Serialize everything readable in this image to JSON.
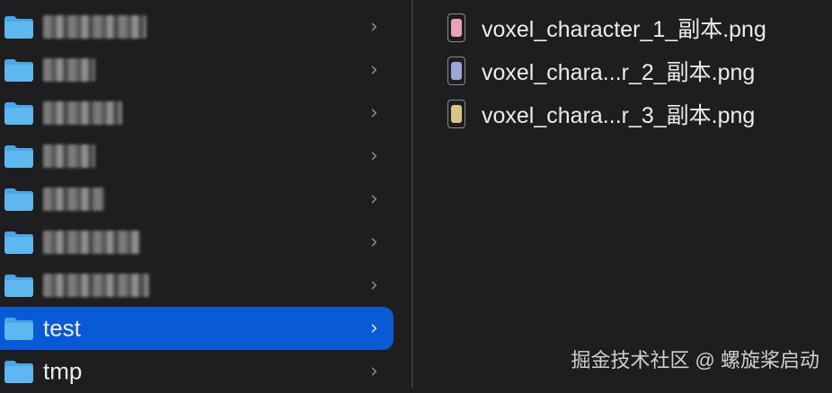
{
  "folders": [
    {
      "name": "ecosystem",
      "obscured": true,
      "selected": false
    },
    {
      "name": "misc",
      "obscured": true,
      "selected": false
    },
    {
      "name": "project",
      "obscured": true,
      "selected": false
    },
    {
      "name": "repo",
      "obscured": true,
      "selected": false
    },
    {
      "name": "data",
      "obscured": true,
      "selected": false
    },
    {
      "name": "design",
      "obscured": true,
      "selected": false
    },
    {
      "name": "software",
      "obscured": true,
      "selected": false
    },
    {
      "name": "test",
      "obscured": false,
      "selected": true
    },
    {
      "name": "tmp",
      "obscured": false,
      "selected": false
    }
  ],
  "chevron": "›",
  "files": [
    {
      "name": "voxel_character_1_副本.png",
      "thumb_color": "#e9a3b6"
    },
    {
      "name": "voxel_chara...r_2_副本.png",
      "thumb_color": "#9aa8d8"
    },
    {
      "name": "voxel_chara...r_3_副本.png",
      "thumb_color": "#d9c48a"
    }
  ],
  "watermark": "掘金技术社区 @ 螺旋桨启动",
  "colors": {
    "selection": "#0a5ad6",
    "folder_fill": "#5fb7f0",
    "folder_tab": "#4aa6e6"
  }
}
